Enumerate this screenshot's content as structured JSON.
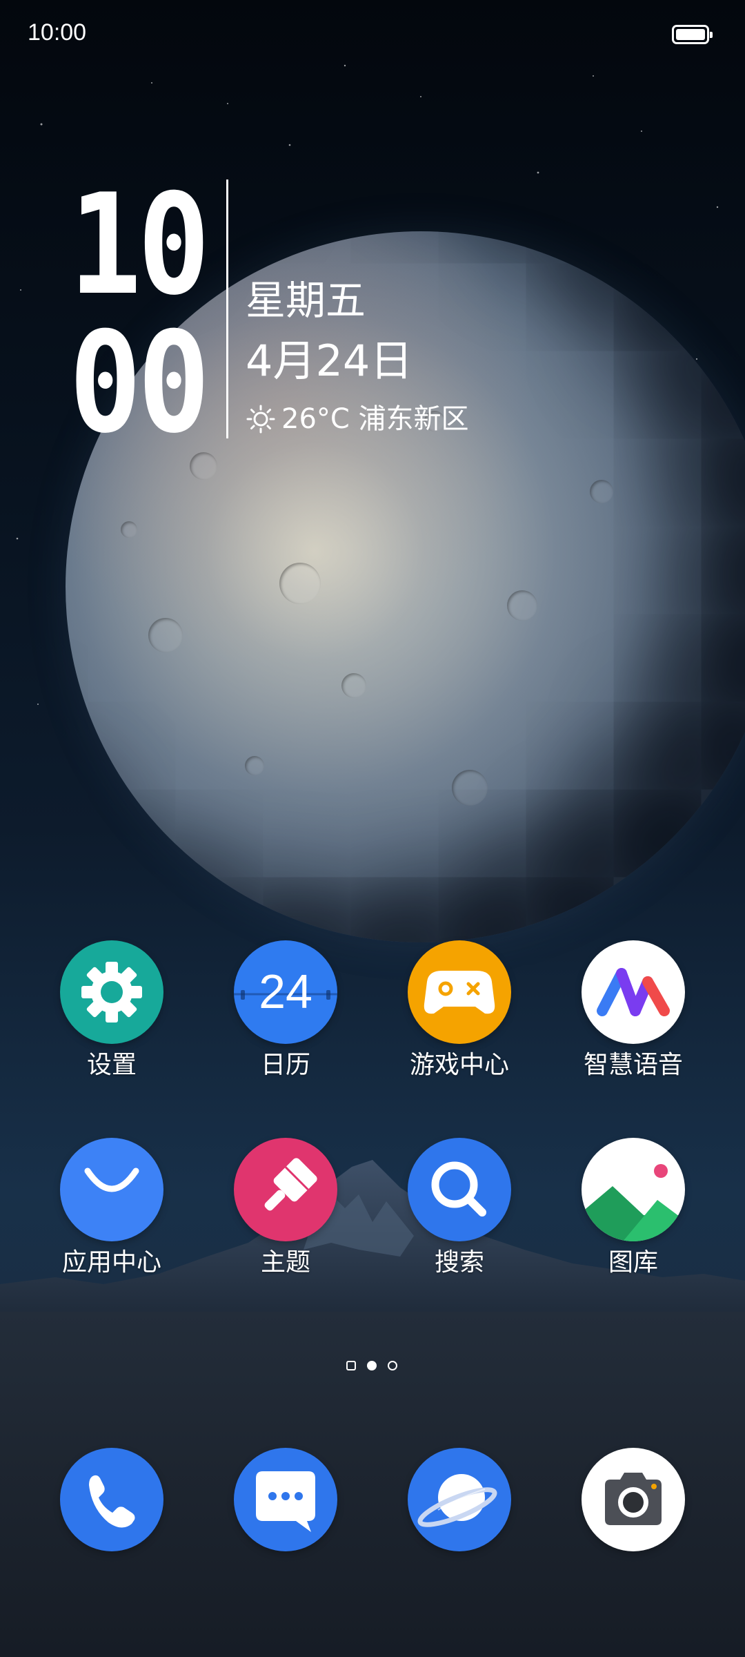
{
  "status_bar": {
    "time": "10:00",
    "battery_icon": "battery-full-icon"
  },
  "widget": {
    "clock_hours": "10",
    "clock_minutes": "00",
    "weekday": "星期五",
    "date": "4月24日",
    "weather_icon": "sun-icon",
    "weather_text": "26°C 浦东新区"
  },
  "home_apps": [
    {
      "label": "设置",
      "icon": "gear-icon",
      "color": "#17a99a"
    },
    {
      "label": "日历",
      "icon": "calendar-icon",
      "color": "#2f7bf0",
      "icon_text": "24"
    },
    {
      "label": "游戏中心",
      "icon": "gamepad-icon",
      "color": "#f5a300"
    },
    {
      "label": "智慧语音",
      "icon": "voice-assistant-icon",
      "color": "#ffffff"
    },
    {
      "label": "应用中心",
      "icon": "shopping-bag-icon",
      "color": "#3d82f6"
    },
    {
      "label": "主题",
      "icon": "paintbrush-icon",
      "color": "#e0356e"
    },
    {
      "label": "搜索",
      "icon": "search-icon",
      "color": "#2f76ec"
    },
    {
      "label": "图库",
      "icon": "gallery-icon",
      "color": "#ffffff"
    }
  ],
  "page_indicator": {
    "pages": 3,
    "current": 2
  },
  "dock": [
    {
      "icon": "phone-icon",
      "color": "#2f76ec"
    },
    {
      "icon": "messages-icon",
      "color": "#2f76ec"
    },
    {
      "icon": "browser-icon",
      "color": "#2f76ec"
    },
    {
      "icon": "camera-icon",
      "color": "#ffffff"
    }
  ]
}
